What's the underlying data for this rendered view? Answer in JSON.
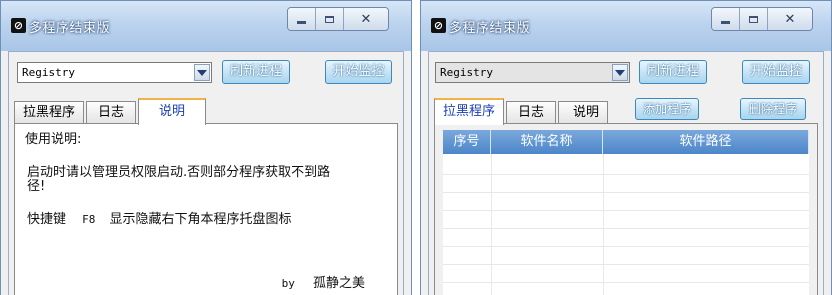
{
  "windows": [
    {
      "title": "多程序结束版",
      "combo_value": "Registry",
      "refresh_label": "刷新进程",
      "start_label": "开始监控",
      "tabs": [
        {
          "label": "拉黑程序",
          "active": false
        },
        {
          "label": "日志",
          "active": false
        },
        {
          "label": "说明",
          "active": true
        }
      ],
      "desc": {
        "line1": "使用说明:",
        "line2": "启动时请以管理员权限启动.否则部分程序获取不到路",
        "line3": "径!",
        "hotkey_label": "快捷键",
        "hotkey_key": "F8",
        "hotkey_desc": "显示隐藏右下角本程序托盘图标",
        "by": "by",
        "author": "孤静之美"
      }
    },
    {
      "title": "多程序结束版",
      "combo_value": "Registry",
      "refresh_label": "刷新进程",
      "start_label": "开始监控",
      "tabs": [
        {
          "label": "拉黑程序",
          "active": true
        },
        {
          "label": "日志",
          "active": false
        },
        {
          "label": "说明",
          "active": false
        }
      ],
      "add_label": "添加程序",
      "delete_label": "删除程序",
      "table_headers": [
        "序号",
        "软件名称",
        "软件路径"
      ]
    }
  ]
}
